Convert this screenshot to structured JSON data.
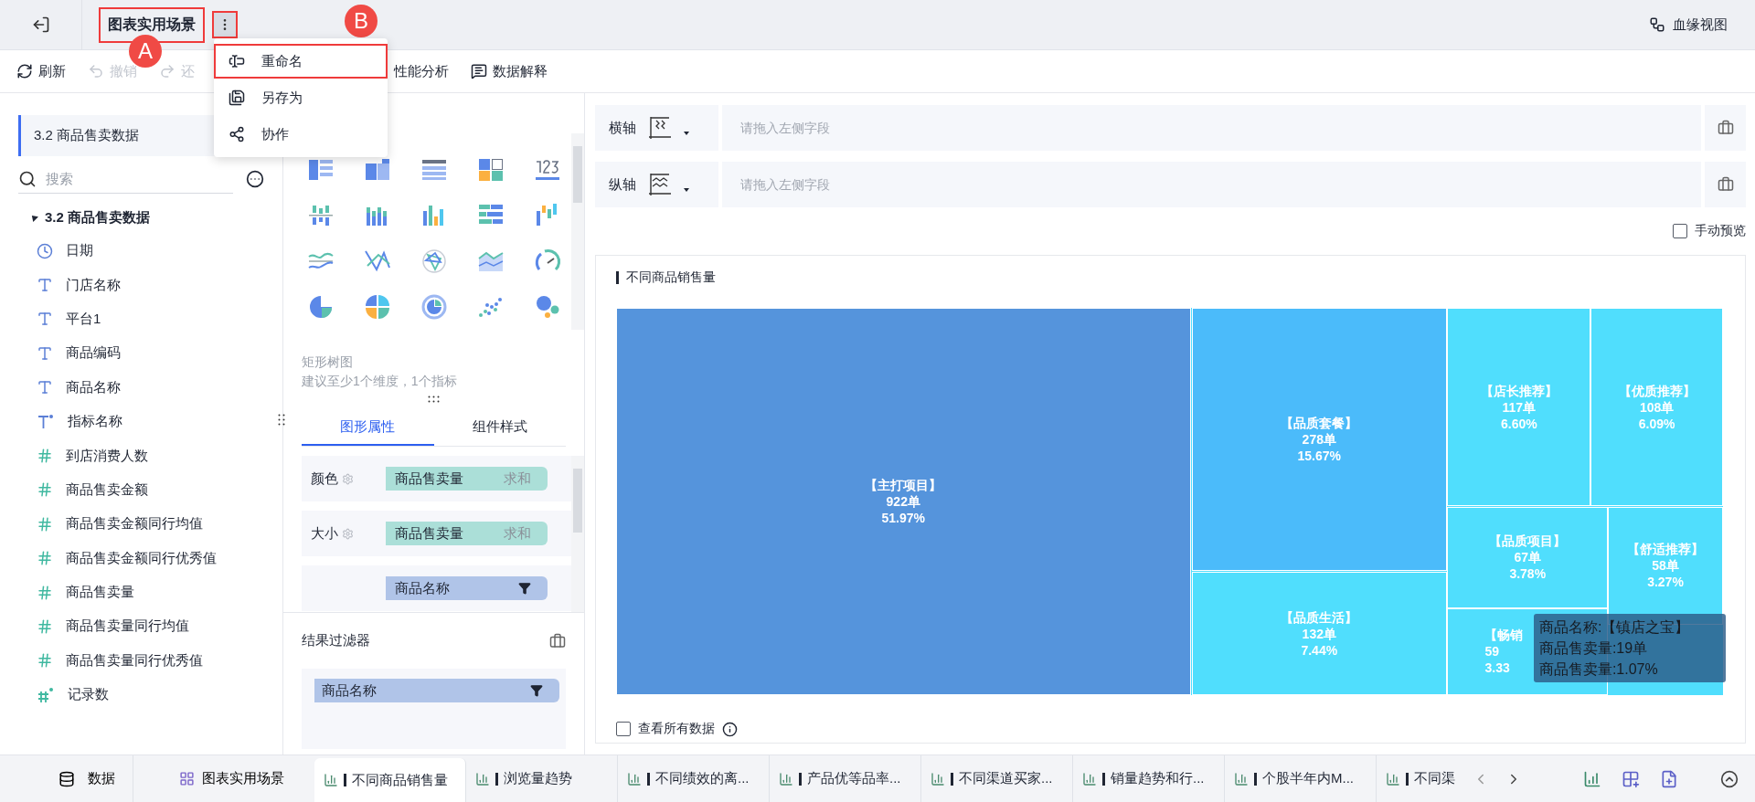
{
  "topbar": {
    "title": "图表实用场景",
    "lineage": "血缘视图"
  },
  "annotations": [
    {
      "label": "A"
    },
    {
      "label": "B"
    }
  ],
  "toolbar": [
    {
      "label": "刷新",
      "disabled": false,
      "kind": "refresh"
    },
    {
      "label": "撤销",
      "disabled": true,
      "kind": "undo"
    },
    {
      "label": "还",
      "disabled": true,
      "kind": "redo"
    },
    {
      "label": "性能分析",
      "disabled": false,
      "kind": "plain"
    },
    {
      "label": "数据解释",
      "disabled": false,
      "kind": "explain"
    }
  ],
  "menu": [
    {
      "label": "重命名",
      "boxed": true,
      "kind": "rename"
    },
    {
      "label": "另存为",
      "boxed": false,
      "kind": "saveas"
    },
    {
      "label": "协作",
      "boxed": false,
      "kind": "share"
    }
  ],
  "dataset": {
    "name": "3.2 商品售卖数据",
    "search_placeholder": "搜索",
    "tree": {
      "label": "3.2 商品售卖数据",
      "expanded": true,
      "children": [
        {
          "label": "日期",
          "kind": "date"
        },
        {
          "label": "门店名称",
          "kind": "text"
        },
        {
          "label": "平台1",
          "kind": "text"
        },
        {
          "label": "商品编码",
          "kind": "text"
        },
        {
          "label": "商品名称",
          "kind": "text"
        },
        {
          "label": "指标名称",
          "kind": "text_calc"
        },
        {
          "label": "到店消费人数",
          "kind": "number"
        },
        {
          "label": "商品售卖金额",
          "kind": "number"
        },
        {
          "label": "商品售卖金额同行均值",
          "kind": "number"
        },
        {
          "label": "商品售卖金额同行优秀值",
          "kind": "number"
        },
        {
          "label": "商品售卖量",
          "kind": "number"
        },
        {
          "label": "商品售卖量同行均值",
          "kind": "number"
        },
        {
          "label": "商品售卖量同行优秀值",
          "kind": "number"
        },
        {
          "label": "记录数",
          "kind": "number_calc"
        }
      ]
    }
  },
  "chart_type_hint": {
    "name": "矩形树图",
    "hint": "建议至少1个维度，1个指标"
  },
  "property_tabs": [
    {
      "label": "图形属性",
      "selected": true
    },
    {
      "label": "组件样式",
      "selected": false
    }
  ],
  "properties": [
    {
      "label": "颜色",
      "field": "商品售卖量",
      "agg": "求和",
      "kind": "measure"
    },
    {
      "label": "大小",
      "field": "商品售卖量",
      "agg": "求和",
      "kind": "measure"
    },
    {
      "field": "商品名称",
      "kind": "dimension"
    }
  ],
  "filter": {
    "title": "结果过滤器",
    "items": [
      {
        "field": "商品名称"
      }
    ]
  },
  "axes": [
    {
      "label": "横轴",
      "placeholder": "请拖入左侧字段",
      "kind": "x"
    },
    {
      "label": "纵轴",
      "placeholder": "请拖入左侧字段",
      "kind": "y"
    }
  ],
  "manual_preview": {
    "label": "手动预览",
    "checked": false
  },
  "chart": {
    "title": "不同商品销售量",
    "cells": [
      {
        "label": "【主打项目】",
        "value": "922单",
        "percent": "51.97%",
        "color": "#5594dc",
        "partial": false
      },
      {
        "label": "【品质套餐】",
        "value": "278单",
        "percent": "15.67%",
        "color": "#4bbbfa",
        "partial": false
      },
      {
        "label": "【品质生活】",
        "value": "132单",
        "percent": "7.44%",
        "color": "#50defd",
        "partial": false
      },
      {
        "label": "【店长推荐】",
        "value": "117单",
        "percent": "6.60%",
        "color": "#50defd",
        "partial": false
      },
      {
        "label": "【优质推荐】",
        "value": "108单",
        "percent": "6.09%",
        "color": "#50defd",
        "partial": false
      },
      {
        "label": "【品质项目】",
        "value": "67单",
        "percent": "3.78%",
        "color": "#50defd",
        "partial": false
      },
      {
        "label": "【舒适推荐】",
        "value": "58单",
        "percent": "3.27%",
        "color": "#50defd",
        "partial": false
      },
      {
        "label": "【畅销",
        "value": "59",
        "percent": "3.33",
        "color": "#50defd",
        "partial": true
      }
    ],
    "tooltip": [
      "商品名称:【镇店之宝】",
      "商品售卖量:19单",
      "商品售卖量:1.07%"
    ],
    "show_all": {
      "label": "查看所有数据",
      "checked": false
    }
  },
  "bottom": {
    "data_label": "数据",
    "dashboard": "图表实用场景",
    "tabs": [
      {
        "label": "不同商品销售量",
        "selected": true
      },
      {
        "label": "浏览量趋势",
        "selected": false
      },
      {
        "label": "不同绩效的离...",
        "selected": false
      },
      {
        "label": "产品优等品率...",
        "selected": false
      },
      {
        "label": "不同渠道买家...",
        "selected": false
      },
      {
        "label": "销量趋势和行...",
        "selected": false
      },
      {
        "label": "个股半年内M...",
        "selected": false
      },
      {
        "label": "不同渠",
        "selected": false
      }
    ]
  }
}
